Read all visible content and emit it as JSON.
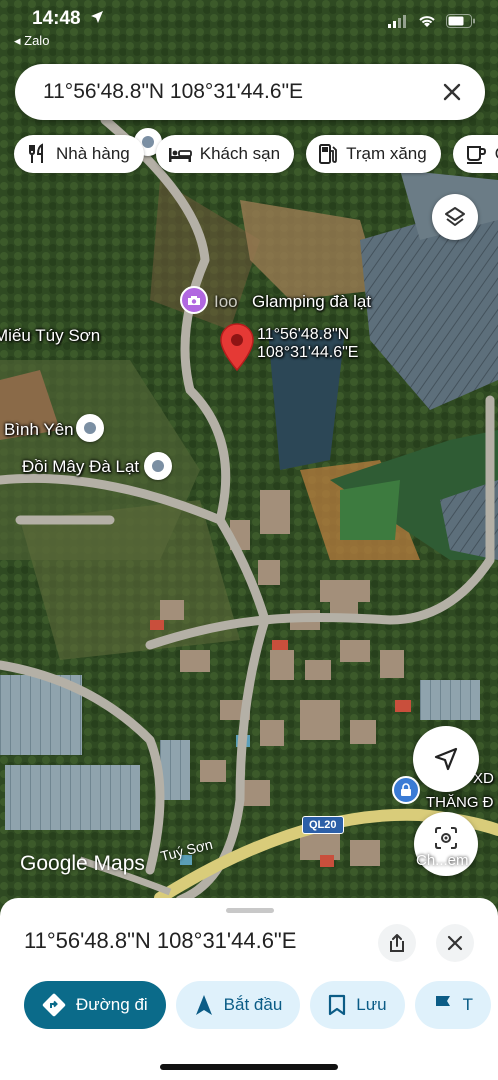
{
  "status_bar": {
    "time": "14:48",
    "back_app": "◂ Zalo"
  },
  "search": {
    "query": "11°56'48.8\"N 108°31'44.6\"E"
  },
  "chips": [
    {
      "label": "Nhà hàng",
      "icon": "restaurant-icon"
    },
    {
      "label": "Khách sạn",
      "icon": "hotel-icon"
    },
    {
      "label": "Trạm xăng",
      "icon": "gas-station-icon"
    },
    {
      "label": "Q",
      "icon": "coffee-icon"
    }
  ],
  "map": {
    "places": {
      "glamping": "Glamping đà lạt",
      "glamping_prefix": "Ioo",
      "tuy_son": "Miếu Túy Sơn",
      "binh_yen": "Bình Yên",
      "doi_may": "Đồi Mây Đà Lạt",
      "thang": "THĂNG Đ",
      "xd": "XD"
    },
    "pin_label_line1": "11°56'48.8\"N",
    "pin_label_line2": "108°31'44.6\"E",
    "road_shield": "QL20",
    "road_name": "Tuý Sơn",
    "logo": "Google Maps",
    "lens_label": "Ch...em",
    "colors": {
      "pin": "#e53935",
      "camp_poi": "#b167e0",
      "lock_poi": "#3a7bd5",
      "primary_button": "#0b6b8a",
      "action_chip": "#dff1fb"
    }
  },
  "sheet": {
    "title": "11°56'48.8\"N 108°31'44.6\"E",
    "actions": [
      {
        "label": "Đường đi",
        "icon": "directions-icon"
      },
      {
        "label": "Bắt đầu",
        "icon": "navigation-arrow-icon"
      },
      {
        "label": "Lưu",
        "icon": "bookmark-icon"
      },
      {
        "label": "T",
        "icon": "flag-icon"
      }
    ]
  }
}
